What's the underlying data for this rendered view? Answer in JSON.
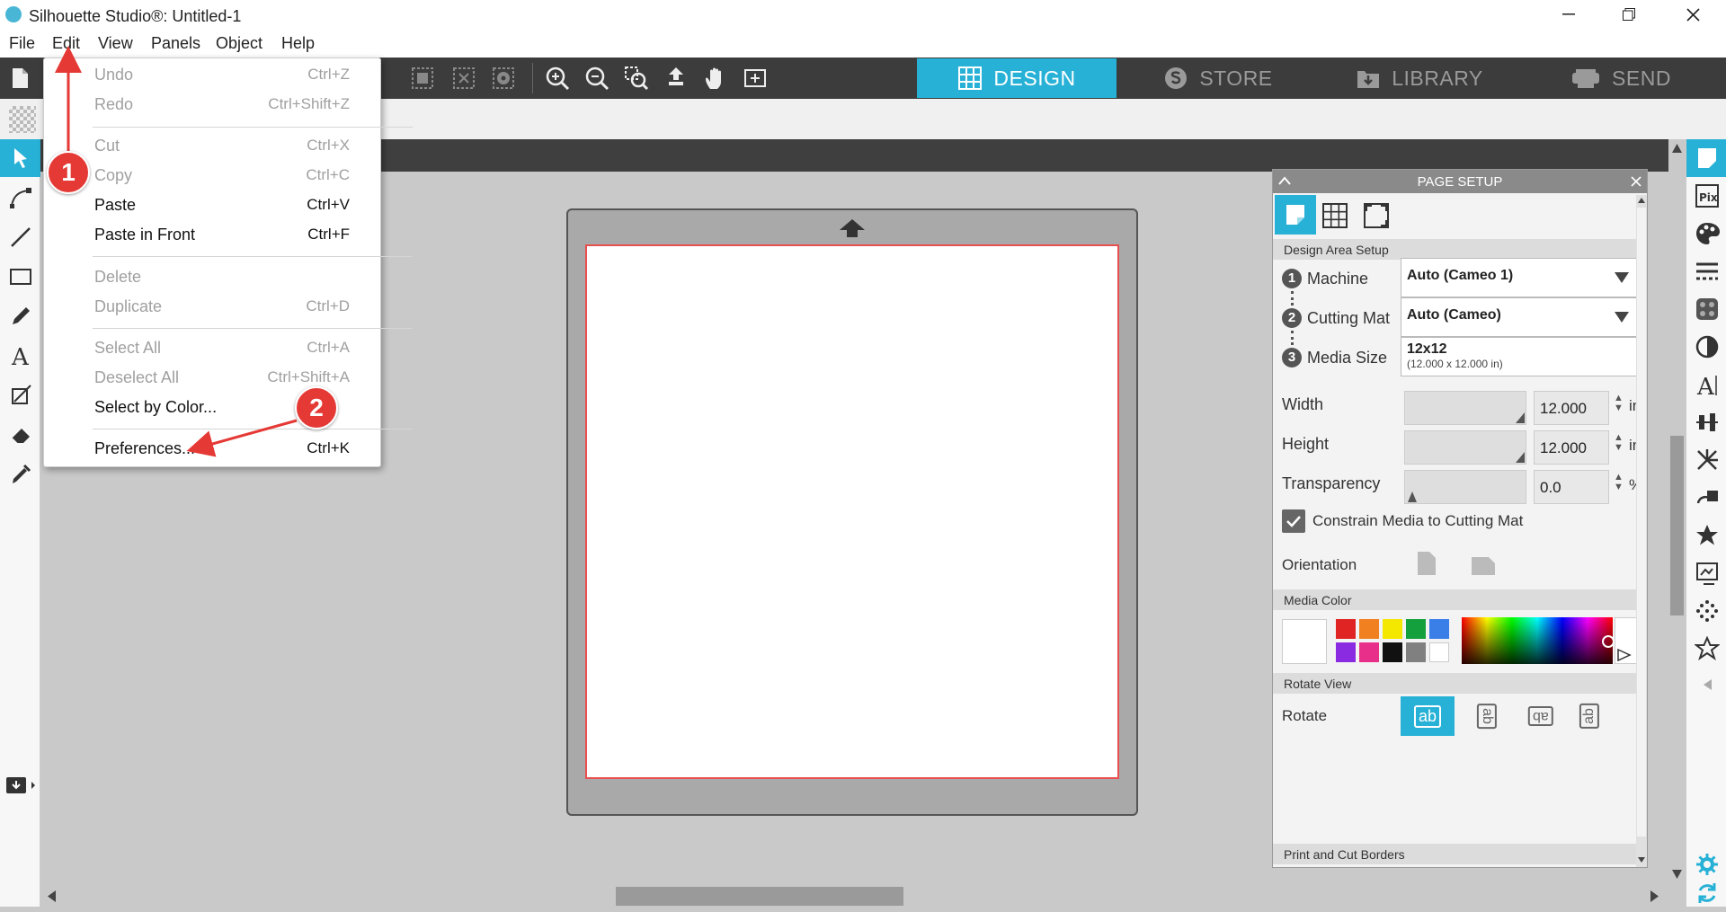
{
  "window": {
    "title": "Silhouette Studio®: Untitled-1"
  },
  "menubar": {
    "items": [
      "File",
      "Edit",
      "View",
      "Panels",
      "Object",
      "Help"
    ]
  },
  "nav_tabs": {
    "design": "DESIGN",
    "store": "STORE",
    "library": "LIBRARY",
    "send": "SEND",
    "active": "DESIGN",
    "active_color": "#27b1d6"
  },
  "edit_menu": {
    "undo": {
      "label": "Undo",
      "shortcut": "Ctrl+Z"
    },
    "redo": {
      "label": "Redo",
      "shortcut": "Ctrl+Shift+Z"
    },
    "cut": {
      "label": "Cut",
      "shortcut": "Ctrl+X"
    },
    "copy": {
      "label": "Copy",
      "shortcut": "Ctrl+C"
    },
    "paste": {
      "label": "Paste",
      "shortcut": "Ctrl+V"
    },
    "paste_front": {
      "label": "Paste in Front",
      "shortcut": "Ctrl+F"
    },
    "delete": {
      "label": "Delete",
      "shortcut": ""
    },
    "duplicate": {
      "label": "Duplicate",
      "shortcut": "Ctrl+D"
    },
    "select_all": {
      "label": "Select All",
      "shortcut": "Ctrl+A"
    },
    "deselect_all": {
      "label": "Deselect All",
      "shortcut": "Ctrl+Shift+A"
    },
    "select_by_color": {
      "label": "Select by Color...",
      "shortcut": ""
    },
    "preferences": {
      "label": "Preferences...",
      "shortcut": "Ctrl+K"
    }
  },
  "callouts": {
    "one": "1",
    "two": "2",
    "color": "#e53935"
  },
  "page_setup": {
    "title": "PAGE SETUP",
    "design_area_setup": "Design Area Setup",
    "step1": "1",
    "step2": "2",
    "step3": "3",
    "machine_label": "Machine",
    "machine_value": "Auto (Cameo 1)",
    "cutting_mat_label": "Cutting Mat",
    "cutting_mat_value": "Auto (Cameo)",
    "media_size_label": "Media Size",
    "media_size_value": "12x12",
    "media_size_detail": "(12.000 x 12.000 in)",
    "width_label": "Width",
    "width_value": "12.000",
    "width_unit": "in",
    "height_label": "Height",
    "height_value": "12.000",
    "height_unit": "in",
    "transparency_label": "Transparency",
    "transparency_value": "0.0",
    "transparency_unit": "%",
    "constrain_label": "Constrain Media to Cutting Mat",
    "constrain_checked": true,
    "orientation_label": "Orientation",
    "media_color_head": "Media Color",
    "media_colors": [
      "#e02424",
      "#f08020",
      "#f5e800",
      "#14a03c",
      "#3a7ee8",
      "#8a2be2",
      "#e8308a",
      "#111111",
      "#808080",
      "#ffffff"
    ],
    "rotate_view_head": "Rotate View",
    "rotate_label": "Rotate",
    "rotate_options": [
      "ab",
      "ab",
      "ab",
      "ab"
    ],
    "print_cut_head": "Print and Cut Borders"
  },
  "icons": {
    "right_bar": [
      "page-setup-icon",
      "pixscan-icon",
      "fill-panel-icon",
      "line-style-icon",
      "fill-pattern-icon",
      "contrast-icon",
      "text-style-icon",
      "align-icon",
      "replicate-icon",
      "transform-icon",
      "library-star-icon",
      "trace-icon",
      "sketch-icon",
      "star-shape-icon",
      "settings-icon",
      "sync-icon"
    ]
  }
}
